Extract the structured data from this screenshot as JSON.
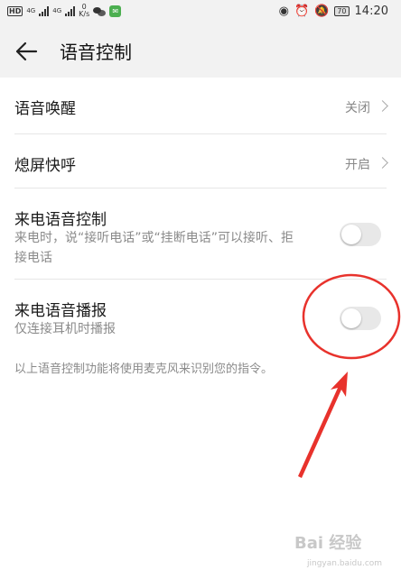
{
  "status_bar": {
    "left_badge": "HD",
    "signal_label_1": "4G",
    "signal_label_2": "4G",
    "speed_value": "0",
    "speed_unit": "K/s",
    "battery": "70",
    "time": "14:20",
    "icons": [
      "hd-icon",
      "signal-icon",
      "wechat-icon",
      "message-icon",
      "eye-icon",
      "alarm-icon",
      "mute-icon",
      "battery-icon"
    ]
  },
  "header": {
    "title": "语音控制",
    "back_icon": "arrow-left-icon"
  },
  "settings": [
    {
      "label": "语音唤醒",
      "value": "关闭",
      "type": "link"
    },
    {
      "label": "熄屏快呼",
      "value": "开启",
      "type": "link"
    },
    {
      "label": "来电语音控制",
      "description": "来电时，说“接听电话”或“挂断电话”可以接听、拒接电话",
      "type": "toggle",
      "enabled": false
    },
    {
      "label": "来电语音播报",
      "description": "仅连接耳机时播报",
      "type": "toggle",
      "enabled": false
    }
  ],
  "footnote": "以上语音控制功能将使用麦克风来识别您的指令。",
  "annotation_color": "#e8322c",
  "watermark": "Bai 经验",
  "watermark_sub": "jingyan.baidu.com"
}
